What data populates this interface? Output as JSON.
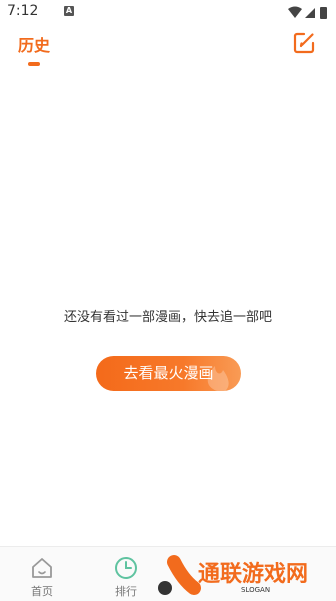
{
  "status_bar": {
    "time": "7:12",
    "notification_letter": "A"
  },
  "header": {
    "title": "历史",
    "edit_icon": "edit-icon"
  },
  "empty_state": {
    "message": "还没有看过一部漫画，快去追一部吧",
    "button_label": "去看最火漫画"
  },
  "bottom_nav": {
    "items": [
      {
        "label": "首页",
        "icon": "home-icon"
      },
      {
        "label": "排行",
        "icon": "clock-icon"
      }
    ]
  },
  "watermark": {
    "text": "通联游戏网",
    "slogan": "SLOGAN"
  },
  "colors": {
    "accent": "#f26b1d",
    "nav_green": "#5fc3a0"
  }
}
